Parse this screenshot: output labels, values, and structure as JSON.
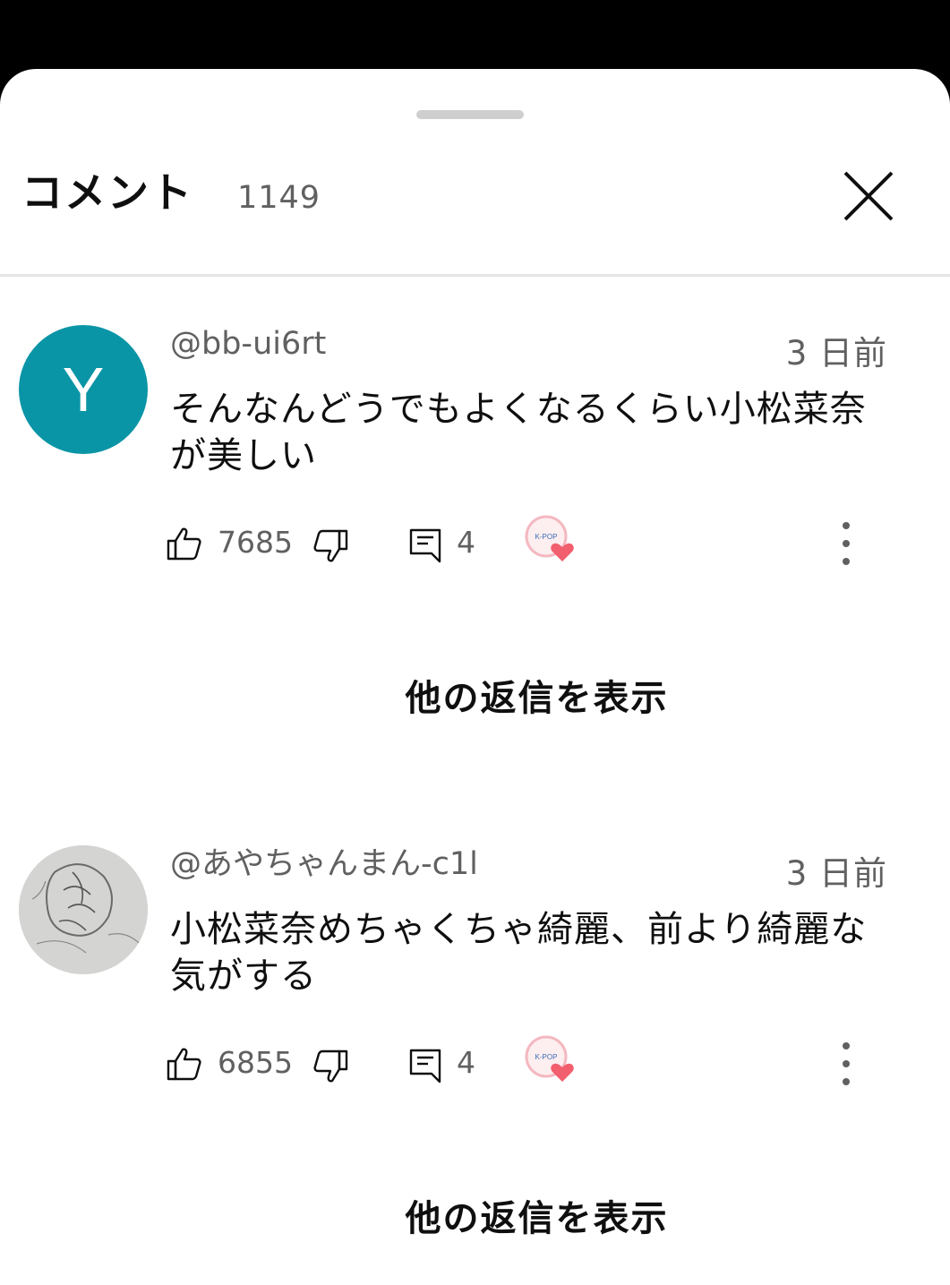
{
  "header": {
    "title": "コメント",
    "count": "1149"
  },
  "comments": [
    {
      "avatar_letter": "Y",
      "avatar_color": "#0a95a6",
      "author": "@bb-ui6rt",
      "time": "3 日前",
      "text": "そんなんどうでもよくなるくらい小松菜奈が美しい",
      "likes": "7685",
      "replies": "4",
      "badge_label": "K-POP",
      "show_replies": "他の返信を表示"
    },
    {
      "avatar_letter": "",
      "avatar_color": "#cfcfcf",
      "author": "@あやちゃんまん-c1l",
      "time": "3 日前",
      "text": "小松菜奈めちゃくちゃ綺麗、前より綺麗な気がする",
      "likes": "6855",
      "replies": "4",
      "badge_label": "K-POP",
      "show_replies": "他の返信を表示"
    }
  ]
}
